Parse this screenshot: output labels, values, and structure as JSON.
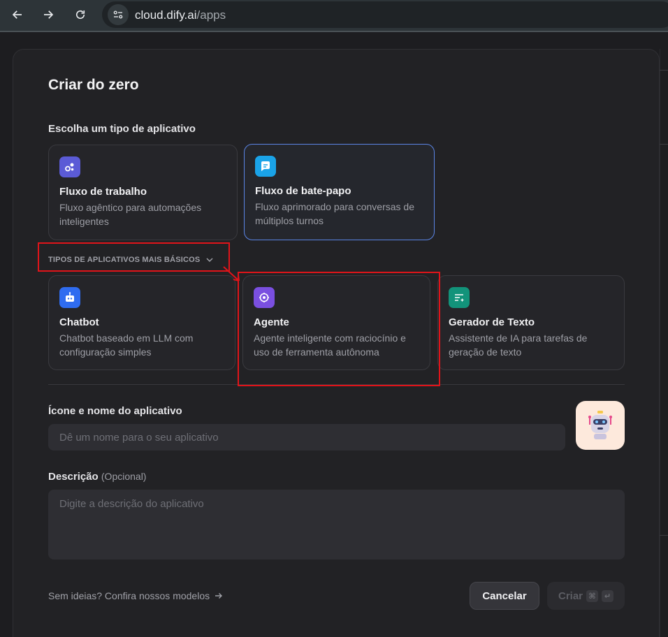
{
  "browser": {
    "url_host": "cloud.dify.ai",
    "url_path": "/apps"
  },
  "modal": {
    "title": "Criar do zero",
    "app_type_label": "Escolha um tipo de aplicativo",
    "primary_types": [
      {
        "title": "Fluxo de trabalho",
        "description": "Fluxo agêntico para automações inteligentes",
        "icon": "workflow-icon",
        "color": "#5b5bd6",
        "selected": false
      },
      {
        "title": "Fluxo de bate-papo",
        "description": "Fluxo aprimorado para conversas de múltiplos turnos",
        "icon": "chatflow-icon",
        "color": "#1aa3e8",
        "selected": true
      }
    ],
    "basic_toggle_label": "TIPOS DE APLICATIVOS MAIS BÁSICOS",
    "basic_types": [
      {
        "title": "Chatbot",
        "description": "Chatbot baseado em LLM com configuração simples",
        "icon": "chatbot-icon",
        "color": "#2f6cf0"
      },
      {
        "title": "Agente",
        "description": "Agente inteligente com raciocínio e uso de ferramenta autônoma",
        "icon": "agent-icon",
        "color": "#7a4fe0"
      },
      {
        "title": "Gerador de Texto",
        "description": "Assistente de IA para tarefas de geração de texto",
        "icon": "text-generator-icon",
        "color": "#12937a"
      }
    ],
    "name_label": "Ícone e nome do aplicativo",
    "name_placeholder": "Dê um nome para o seu aplicativo",
    "description_label": "Descrição",
    "description_optional": "(Opcional)",
    "description_placeholder": "Digite a descrição do aplicativo",
    "ideas_link": "Sem ideias? Confira nossos modelos",
    "cancel_label": "Cancelar",
    "create_label": "Criar"
  },
  "annotation_color": "#e0141a"
}
